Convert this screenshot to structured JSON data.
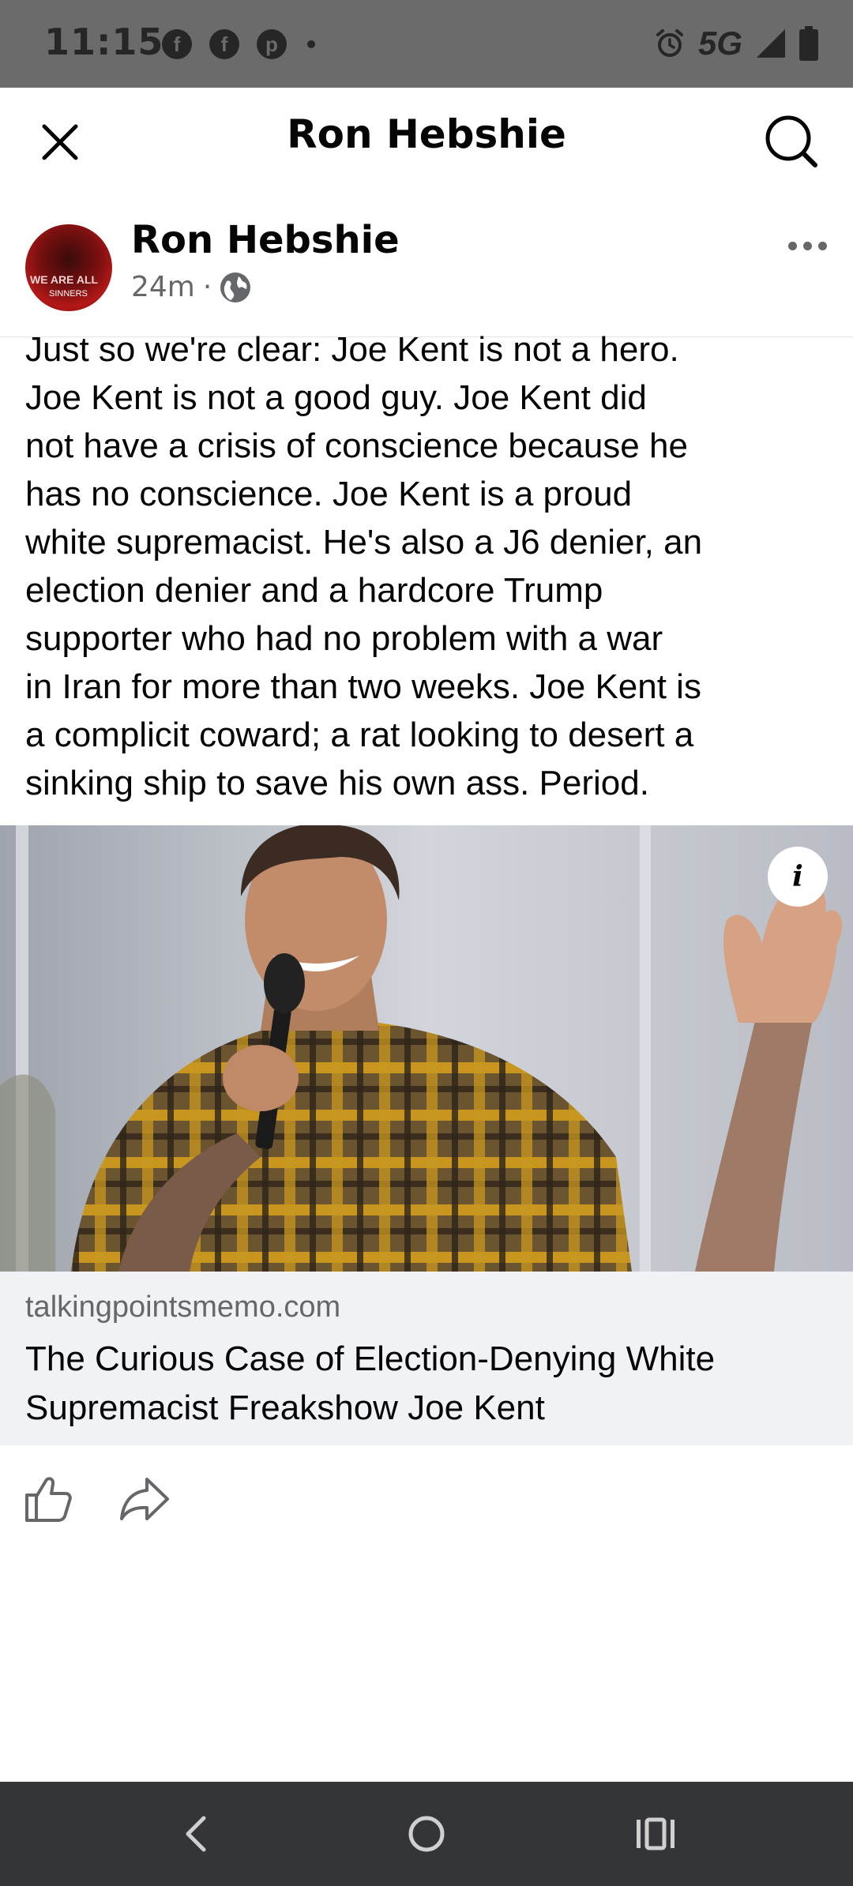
{
  "status_bar": {
    "time": "11:15",
    "notification_icons": [
      "facebook-icon",
      "facebook-icon",
      "pinterest-icon"
    ],
    "network": "5G",
    "icons": [
      "alarm-icon",
      "signal-icon",
      "battery-icon"
    ]
  },
  "header": {
    "title": "Ron Hebshie"
  },
  "post": {
    "author": "Ron Hebshie",
    "time": "24m",
    "separator": "·",
    "audience_icon": "globe-icon",
    "text": "Just so we're clear: Joe Kent is not a hero.\nJoe Kent is not a good guy. Joe Kent did\nnot have a crisis of conscience because he\nhas no conscience. Joe Kent is a proud\nwhite supremacist. He's also a J6 denier, an\nelection denier and a hardcore Trump\nsupporter who had no problem with a war\nin Iran for more than two weeks. Joe Kent is\na complicit coward; a rat looking to desert a\nsinking ship to save his own ass. Period.",
    "avatar_text": "WE ARE ALL",
    "avatar_text2": "SINNERS"
  },
  "link": {
    "info_label": "i",
    "domain": "talkingpointsmemo.com",
    "title": "The Curious Case of Election-Denying White Supremacist Freakshow Joe Kent"
  },
  "colors": {
    "status_bar_bg": "#6b6b6b",
    "link_card_bg": "#f0f2f5",
    "nav_bar_bg": "#343538",
    "secondary_text": "#65676b"
  }
}
